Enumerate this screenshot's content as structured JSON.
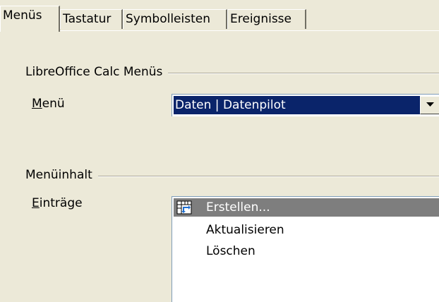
{
  "tabs": [
    {
      "label": "Menüs",
      "active": true
    },
    {
      "label": "Tastatur",
      "active": false
    },
    {
      "label": "Symbolleisten",
      "active": false
    },
    {
      "label": "Ereignisse",
      "active": false
    }
  ],
  "menus_group": {
    "title": "LibreOffice Calc Menüs",
    "menu_label_mnemonic": "M",
    "menu_label_rest": "enü",
    "menu_value": "Daten | Datenpilot"
  },
  "content_group": {
    "title": "Menüinhalt",
    "entries_label_mnemonic": "E",
    "entries_label_rest": "inträge",
    "entries": [
      {
        "label": "Erstellen...",
        "icon": "pivot-table-icon",
        "selected": true
      },
      {
        "label": "Aktualisieren",
        "selected": false
      },
      {
        "label": "Löschen",
        "selected": false
      }
    ]
  },
  "colors": {
    "dialog_bg": "#ece9d8",
    "selection": "#0a246a",
    "inactive_selection": "#7e7e7e"
  }
}
